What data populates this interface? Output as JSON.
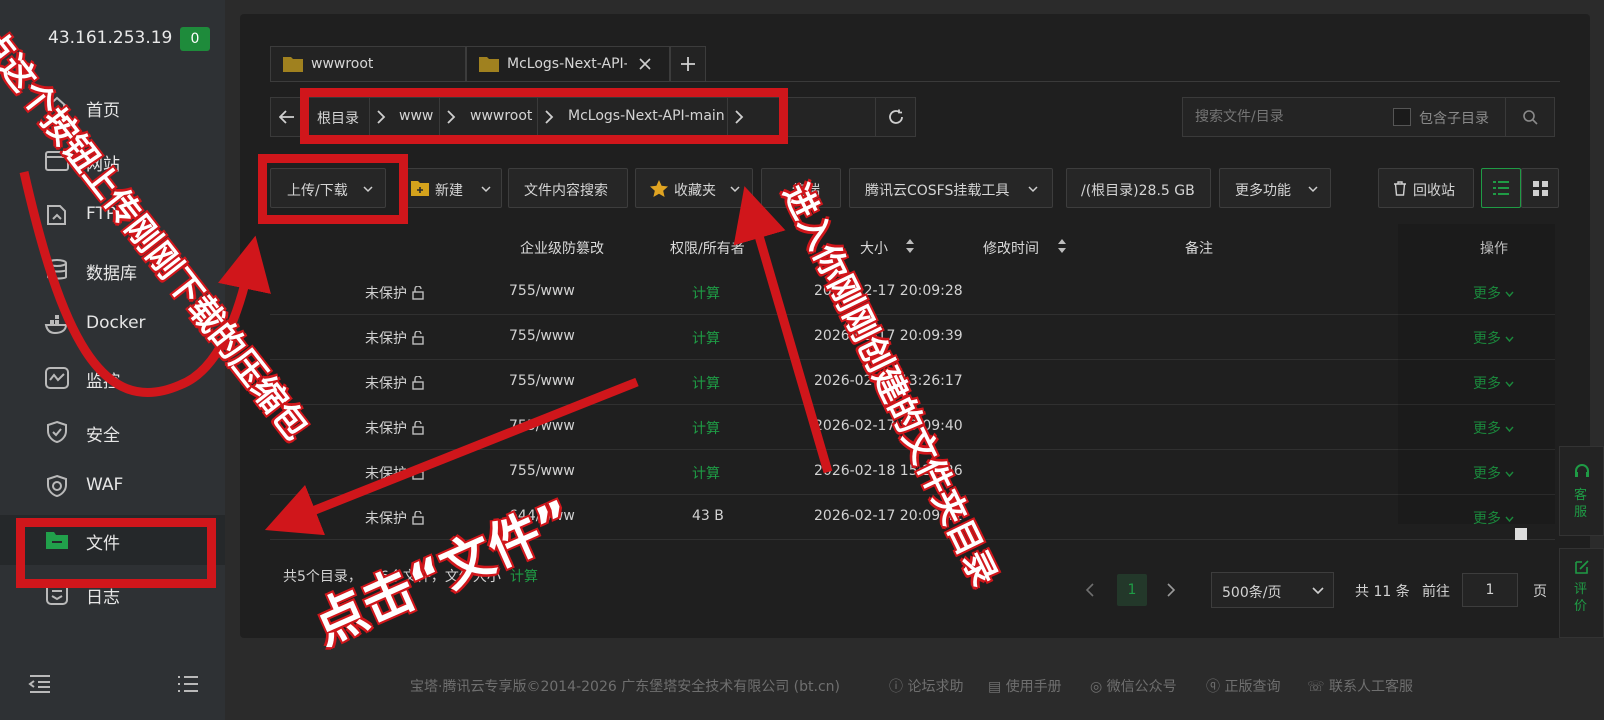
{
  "sidebar": {
    "server_ip": "43.161.253.19",
    "badge": "0",
    "items": [
      {
        "label": "首页",
        "icon": "home-icon"
      },
      {
        "label": "网站",
        "icon": "website-icon"
      },
      {
        "label": "FTP",
        "icon": "ftp-icon"
      },
      {
        "label": "数据库",
        "icon": "database-icon"
      },
      {
        "label": "Docker",
        "icon": "docker-icon"
      },
      {
        "label": "监控",
        "icon": "monitor-icon"
      },
      {
        "label": "安全",
        "icon": "shield-icon"
      },
      {
        "label": "WAF",
        "icon": "waf-icon"
      },
      {
        "label": "文件",
        "icon": "folder-icon"
      },
      {
        "label": "日志",
        "icon": "log-icon"
      }
    ]
  },
  "tabs": [
    {
      "label": "wwwroot"
    },
    {
      "label": "McLogs-Next-API-main"
    }
  ],
  "breadcrumbs": [
    "根目录",
    "www",
    "wwwroot",
    "McLogs-Next-API-main"
  ],
  "search": {
    "placeholder": "搜索文件/目录",
    "subdir_label": "包含子目录"
  },
  "toolbar": {
    "upload": "上传/下载",
    "new": "新建",
    "content_search": "文件内容搜索",
    "favorites": "收藏夹",
    "terminal": "终端",
    "cosfs": "腾讯云COSFS挂载工具",
    "disk": "/(根目录)28.5 GB",
    "more": "更多功能",
    "recycle": "回收站"
  },
  "table": {
    "headers": {
      "protect": "企业级防篡改",
      "perm": "权限/所有者",
      "size": "大小",
      "mtime": "修改时间",
      "note": "备注",
      "ops": "操作"
    },
    "rows": [
      {
        "protect": "未保护",
        "perm": "755/www",
        "size": "计算",
        "mtime": "2026-02-17 20:09:28",
        "op": "更多"
      },
      {
        "protect": "未保护",
        "perm": "755/www",
        "size": "计算",
        "mtime": "2026-02-17 20:09:39",
        "op": "更多"
      },
      {
        "protect": "未保护",
        "perm": "755/www",
        "size": "计算",
        "mtime": "2026-02-18 13:26:17",
        "op": "更多"
      },
      {
        "protect": "未保护",
        "perm": "755/www",
        "size": "计算",
        "mtime": "2026-02-17 20:09:40",
        "op": "更多"
      },
      {
        "protect": "未保护",
        "perm": "755/www",
        "size": "计算",
        "mtime": "2026-02-18 15:29:26",
        "op": "更多"
      },
      {
        "protect": "未保护",
        "perm": "644/www",
        "size": "43 B",
        "mtime": "2026-02-17 20:09:41",
        "op": "更多"
      }
    ]
  },
  "summary": {
    "prefix": "共5个目录，",
    "files": "6个文件，文件大小",
    "calc": "计算"
  },
  "pagination": {
    "current": "1",
    "per_page": "500条/页",
    "total": "共 11 条",
    "goto": "前往",
    "page_input": "1",
    "page_suffix": "页"
  },
  "side_tools": {
    "service": "客服",
    "review": "评价"
  },
  "footer": {
    "copyright": "宝塔·腾讯云专享版©2014-2026 广东堡塔安全技术有限公司 (bt.cn)",
    "links": [
      "论坛求助",
      "使用手册",
      "微信公众号",
      "正版查询",
      "联系人工客服"
    ]
  },
  "annotations": {
    "left": "点这个按钮上传刚刚下载的压缩包",
    "bottom": "点击“文件”",
    "right": "进入你刚刚创建的文件夹目录"
  },
  "colors": {
    "accent": "#1f9b45",
    "annotation": "#d0161b"
  }
}
